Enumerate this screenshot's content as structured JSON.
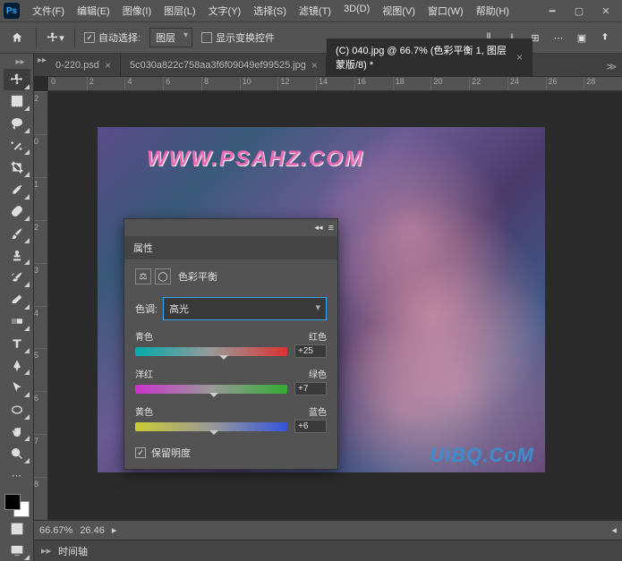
{
  "menu": {
    "items": [
      "文件(F)",
      "编辑(E)",
      "图像(I)",
      "图层(L)",
      "文字(Y)",
      "选择(S)",
      "滤镜(T)",
      "3D(D)",
      "视图(V)",
      "窗口(W)",
      "帮助(H)"
    ]
  },
  "options": {
    "auto_select": "自动选择:",
    "layer_dropdown": "图层",
    "show_transform": "显示变换控件"
  },
  "tabs": [
    {
      "label": "0-220.psd",
      "active": false
    },
    {
      "label": "5c030a822c758aa3f6f09049ef99525.jpg",
      "active": false
    },
    {
      "label": "(C) 040.jpg @ 66.7% (色彩平衡 1, 图层蒙版/8) *",
      "active": true
    }
  ],
  "ruler_h": [
    "0",
    "2",
    "4",
    "6",
    "8",
    "10",
    "12",
    "14",
    "16",
    "18",
    "20",
    "22",
    "24",
    "26",
    "28"
  ],
  "ruler_v": [
    "2",
    "0",
    "1",
    "2",
    "3",
    "4",
    "5",
    "6",
    "7",
    "8"
  ],
  "watermark": {
    "top": "WWW.PSAHZ.COM",
    "bottom": "UiBQ.CoM"
  },
  "panel": {
    "title": "属性",
    "adjustment": "色彩平衡",
    "tone_label": "色调:",
    "tone_value": "高光",
    "sliders": [
      {
        "left": "青色",
        "right": "红色",
        "value": "+25",
        "pos": 58
      },
      {
        "left": "洋红",
        "right": "绿色",
        "value": "+7",
        "pos": 52
      },
      {
        "left": "黄色",
        "right": "蓝色",
        "value": "+6",
        "pos": 52
      }
    ],
    "preserve": "保留明度"
  },
  "status": {
    "zoom": "66.67%",
    "coords": "26.46"
  },
  "timeline": {
    "label": "时间轴"
  }
}
